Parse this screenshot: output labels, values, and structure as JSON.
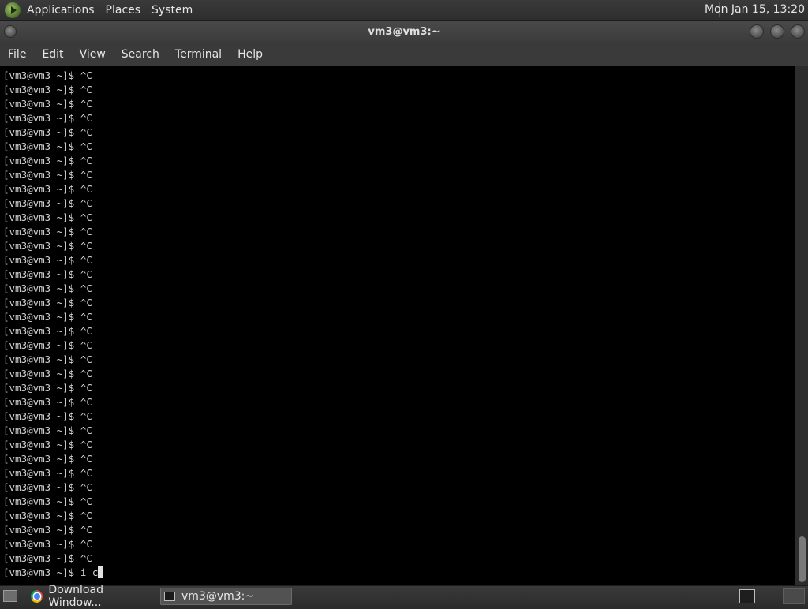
{
  "panel": {
    "menus": [
      "Applications",
      "Places",
      "System"
    ],
    "clock": "Mon Jan 15, 13:20"
  },
  "window": {
    "title": "vm3@vm3:~"
  },
  "menubar": [
    "File",
    "Edit",
    "View",
    "Search",
    "Terminal",
    "Help"
  ],
  "terminal": {
    "prompt": "[vm3@vm3 ~]$ ",
    "repeated_output": "^C",
    "repeated_count": 35,
    "current_input": "i c"
  },
  "taskbar": {
    "tasks": [
      {
        "label": "Download Window...",
        "icon": "chrome-icon",
        "active": false
      },
      {
        "label": "vm3@vm3:~",
        "icon": "terminal-icon",
        "active": true
      }
    ]
  }
}
